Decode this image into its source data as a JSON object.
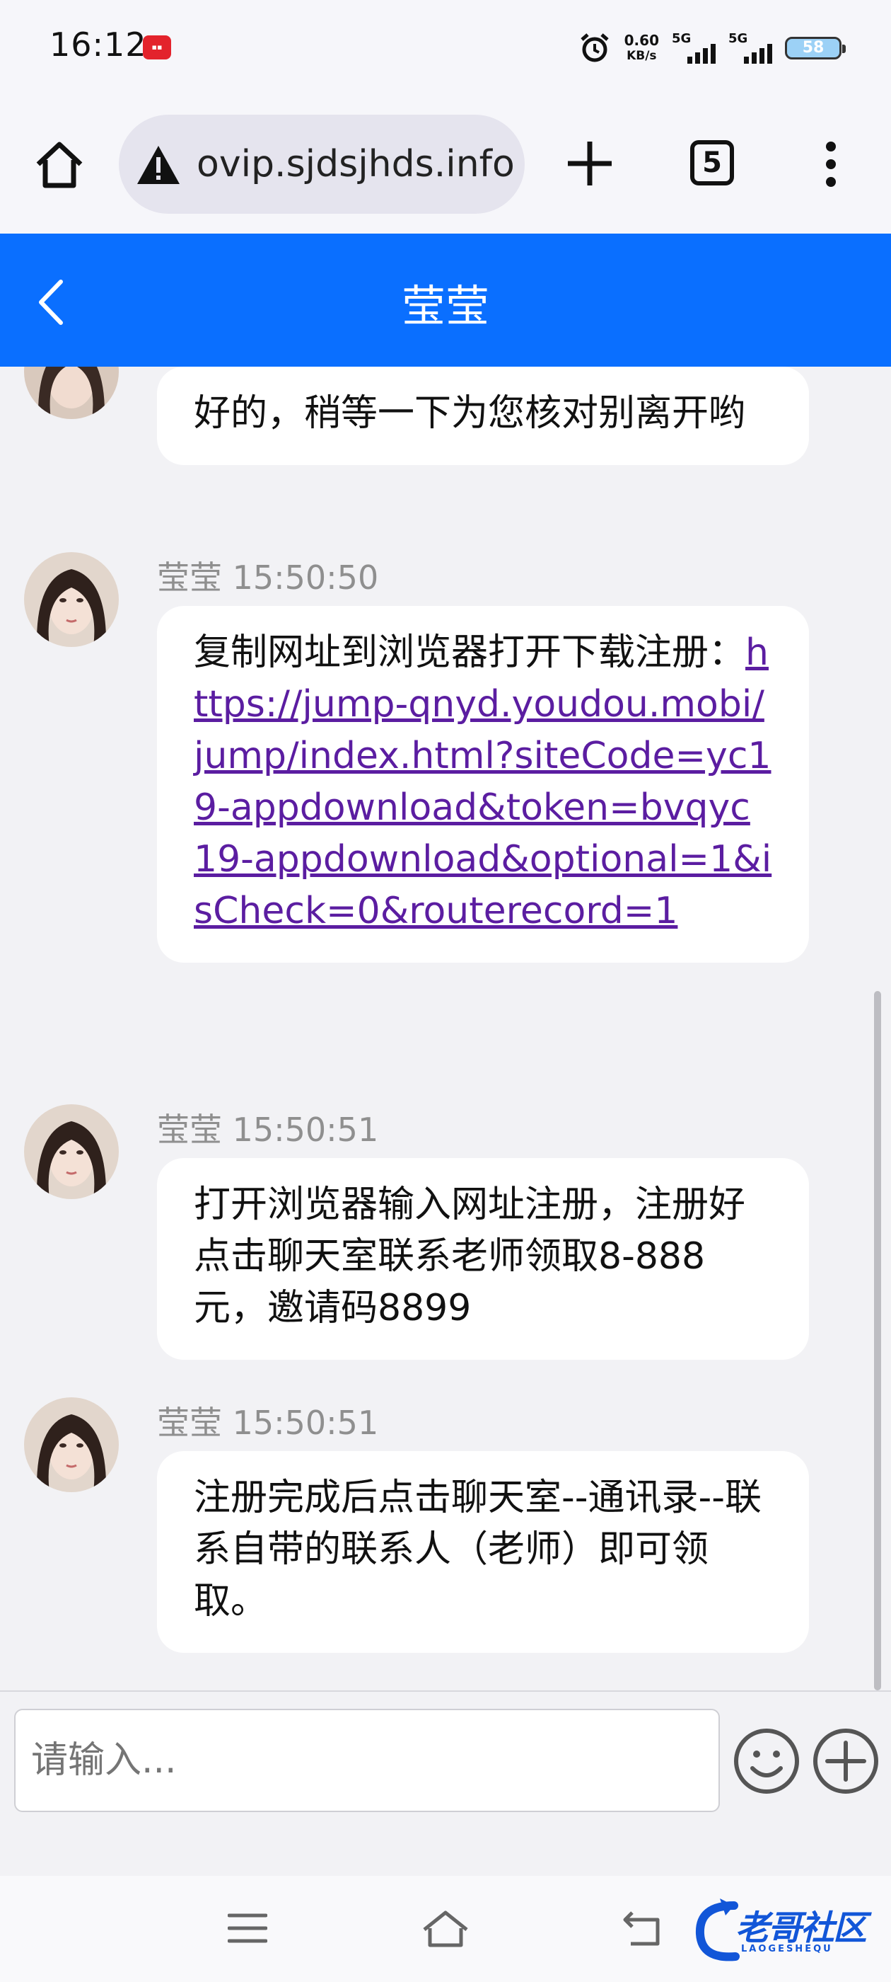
{
  "status_bar": {
    "time": "16:12",
    "net_speed_value": "0.60",
    "net_speed_unit": "KB/s",
    "signal_1": "5G",
    "signal_2": "5G",
    "battery": "58"
  },
  "browser": {
    "url": "ovip.sjdsjhds.info",
    "tab_count": "5"
  },
  "chat": {
    "title": "莹莹",
    "messages": [
      {
        "sender": "",
        "time": "",
        "text": "好的，稍等一下为您核对别离开哟"
      },
      {
        "sender": "莹莹",
        "time": "莹莹 15:50:50",
        "text_prefix": "复制网址到浏览器打开下载注册：",
        "link": "https://jump-qnyd.youdou.mobi/jump/index.html?siteCode=yc19-appdownload&token=bvqyc19-appdownload&optional=1&isCheck=0&routerecord=1"
      },
      {
        "sender": "莹莹",
        "time": "莹莹 15:50:51",
        "text": "打开浏览器输入网址注册，注册好点击聊天室联系老师领取8-888元，邀请码8899"
      },
      {
        "sender": "莹莹",
        "time": "莹莹 15:50:51",
        "text": "注册完成后点击聊天室--通讯录--联系自带的联系人（老师）即可领取。"
      }
    ],
    "input_placeholder": "请输入..."
  },
  "watermark": {
    "text": "老哥社区",
    "sub": "LAOGESHEQU"
  }
}
